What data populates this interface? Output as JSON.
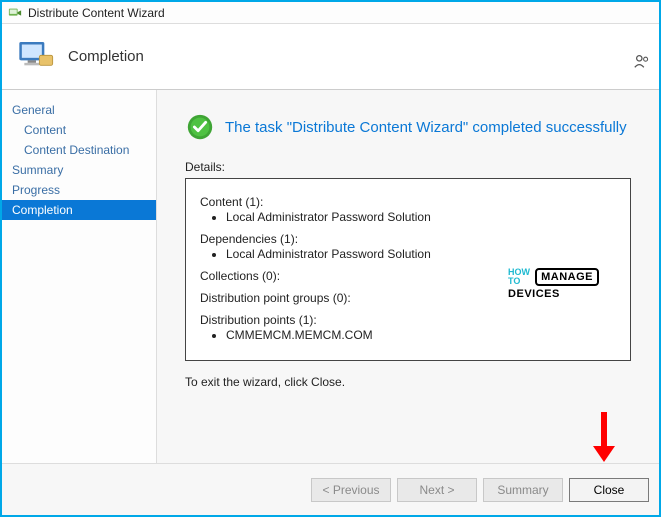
{
  "window": {
    "title": "Distribute Content Wizard"
  },
  "header": {
    "page_title": "Completion"
  },
  "sidebar": {
    "items": [
      {
        "label": "General",
        "indent": 0
      },
      {
        "label": "Content",
        "indent": 1
      },
      {
        "label": "Content Destination",
        "indent": 1
      },
      {
        "label": "Summary",
        "indent": 0
      },
      {
        "label": "Progress",
        "indent": 0
      },
      {
        "label": "Completion",
        "indent": 0,
        "selected": true
      }
    ]
  },
  "main": {
    "success_message": "The task \"Distribute Content Wizard\" completed successfully",
    "details_label": "Details:",
    "details": {
      "content": {
        "title": "Content (1):",
        "items": [
          "Local Administrator Password Solution"
        ]
      },
      "dependencies": {
        "title": "Dependencies (1):",
        "items": [
          "Local Administrator Password Solution"
        ]
      },
      "collections": {
        "title": "Collections (0):"
      },
      "dpg": {
        "title": "Distribution point groups (0):"
      },
      "dp": {
        "title": "Distribution points (1):",
        "items": [
          "CMMEMCM.MEMCM.COM"
        ]
      }
    },
    "exit_line": "To exit the wizard, click Close."
  },
  "watermark": {
    "how": "HOW",
    "to": "TO",
    "manage": "MANAGE",
    "devices": "DEVICES"
  },
  "footer": {
    "previous": "< Previous",
    "next": "Next >",
    "summary": "Summary",
    "close": "Close"
  }
}
